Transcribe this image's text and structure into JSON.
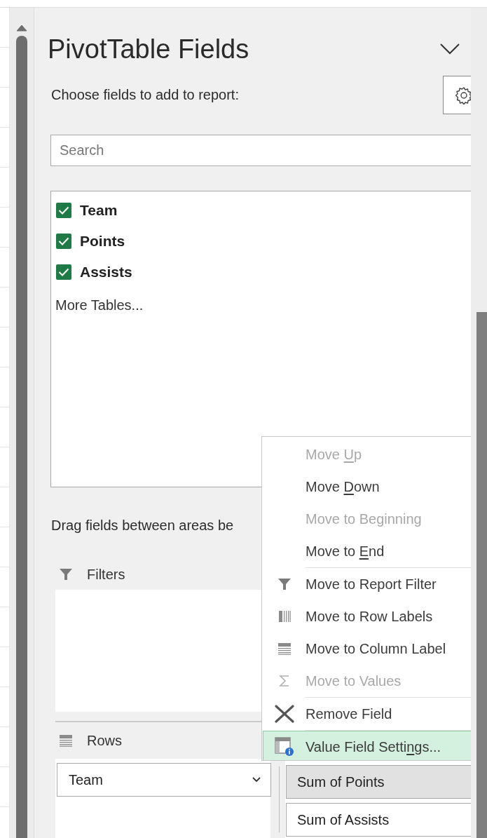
{
  "panel": {
    "title": "PivotTable Fields",
    "subtitle": "Choose fields to add to report:"
  },
  "search": {
    "placeholder": "Search"
  },
  "fields": [
    {
      "label": "Team",
      "checked": true
    },
    {
      "label": "Points",
      "checked": true
    },
    {
      "label": "Assists",
      "checked": true
    }
  ],
  "more_tables": "More Tables...",
  "drag_hint": "Drag fields between areas be",
  "areas": {
    "filters": {
      "label": "Filters"
    },
    "rows": {
      "label": "Rows",
      "items": [
        {
          "label": "Team"
        }
      ]
    },
    "values": {
      "items": [
        {
          "label": "Sum of Points",
          "selected": true
        },
        {
          "label": "Sum of Assists",
          "selected": false
        }
      ]
    }
  },
  "context_menu": {
    "items": [
      {
        "kind": "plain",
        "label_parts": {
          "before": "Move ",
          "key": "U",
          "after": "p"
        },
        "disabled": true,
        "separator_before": false,
        "highlighted": false
      },
      {
        "kind": "plain",
        "label_parts": {
          "before": "Move ",
          "key": "D",
          "after": "own"
        },
        "disabled": false,
        "separator_before": false,
        "highlighted": false
      },
      {
        "kind": "plain",
        "label_parts": {
          "before": "Move to Be",
          "key": "g",
          "after": "inning"
        },
        "disabled": true,
        "separator_before": false,
        "highlighted": false
      },
      {
        "kind": "plain",
        "label_parts": {
          "before": "Move to ",
          "key": "E",
          "after": "nd"
        },
        "disabled": false,
        "separator_before": false,
        "highlighted": false
      },
      {
        "kind": "filter",
        "label": "Move to Report Filter",
        "disabled": false,
        "separator_before": true,
        "highlighted": false
      },
      {
        "kind": "rows",
        "label": "Move to Row Labels",
        "disabled": false,
        "separator_before": false,
        "highlighted": false
      },
      {
        "kind": "columns",
        "label": "Move to Column Label",
        "disabled": false,
        "separator_before": false,
        "highlighted": false
      },
      {
        "kind": "sigma",
        "label": "Move to Values",
        "disabled": true,
        "separator_before": false,
        "highlighted": false
      },
      {
        "kind": "remove",
        "label": "Remove Field",
        "disabled": false,
        "separator_before": true,
        "highlighted": false
      },
      {
        "kind": "settings",
        "label_parts": {
          "before": "Value Field Setti",
          "key": "n",
          "after": "gs..."
        },
        "disabled": false,
        "separator_before": true,
        "highlighted": true
      }
    ]
  }
}
